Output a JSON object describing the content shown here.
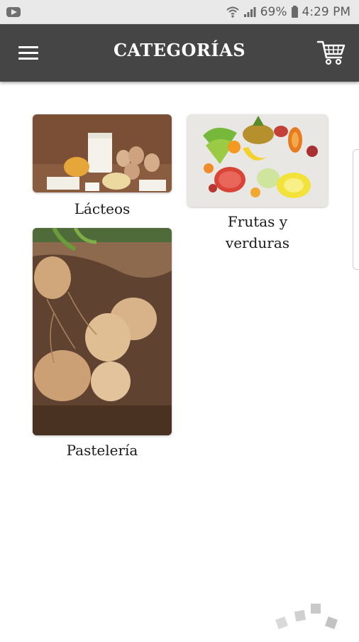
{
  "status_bar": {
    "battery": "69%",
    "time": "4:29 PM"
  },
  "header": {
    "title": "CATEGORÍAS",
    "menu_icon": "hamburger-menu-icon",
    "cart_icon": "shopping-cart-icon"
  },
  "categories": [
    {
      "label": "Lácteos"
    },
    {
      "label": "Frutas y verduras"
    },
    {
      "label": "Pastelería"
    }
  ],
  "colors": {
    "header_bg": "#454545",
    "status_bar_bg": "#e9e9e9",
    "page_bg": "#ffffff"
  }
}
